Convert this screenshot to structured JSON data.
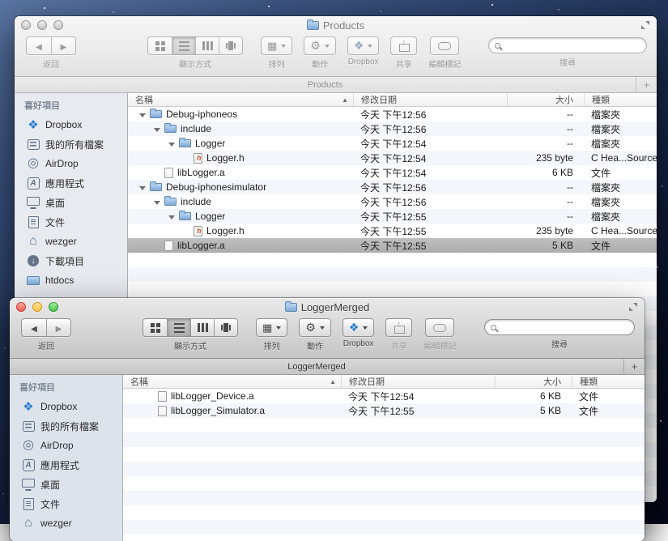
{
  "chrome": {
    "toolbar": {
      "back_label": "返回",
      "view_label": "顯示方式",
      "arrange_label": "排列",
      "action_label": "動作",
      "dropbox_label": "Dropbox",
      "share_label": "共享",
      "tags_label": "編輯標記",
      "search_label": "搜尋",
      "search_value": ""
    },
    "columns": {
      "name": "名稱",
      "date": "修改日期",
      "size": "大小",
      "kind": "種類",
      "sort_asc": "▲"
    },
    "new_tab_label": "+",
    "sidebar": {
      "heading": "喜好項目",
      "items": [
        {
          "label": "Dropbox",
          "icon": "dropbox-icon"
        },
        {
          "label": "我的所有檔案",
          "icon": "all-my-files-icon"
        },
        {
          "label": "AirDrop",
          "icon": "airdrop-icon"
        },
        {
          "label": "應用程式",
          "icon": "applications-icon"
        },
        {
          "label": "桌面",
          "icon": "desktop-icon"
        },
        {
          "label": "文件",
          "icon": "documents-icon"
        },
        {
          "label": "wezger",
          "icon": "home-icon"
        },
        {
          "label": "下載項目",
          "icon": "downloads-icon"
        },
        {
          "label": "htdocs",
          "icon": "folder-icon"
        }
      ]
    }
  },
  "window1": {
    "title": "Products",
    "tab": "Products",
    "rows": [
      {
        "name": "Debug-iphoneos",
        "date": "今天 下午12:56",
        "size": "--",
        "kind": "檔案夾"
      },
      {
        "name": "include",
        "date": "今天 下午12:56",
        "size": "--",
        "kind": "檔案夾"
      },
      {
        "name": "Logger",
        "date": "今天 下午12:54",
        "size": "--",
        "kind": "檔案夾"
      },
      {
        "name": "Logger.h",
        "date": "今天 下午12:54",
        "size": "235 byte",
        "kind": "C Hea...Source"
      },
      {
        "name": "libLogger.a",
        "date": "今天 下午12:54",
        "size": "6 KB",
        "kind": "文件"
      },
      {
        "name": "Debug-iphonesimulator",
        "date": "今天 下午12:56",
        "size": "--",
        "kind": "檔案夾"
      },
      {
        "name": "include",
        "date": "今天 下午12:56",
        "size": "--",
        "kind": "檔案夾"
      },
      {
        "name": "Logger",
        "date": "今天 下午12:55",
        "size": "--",
        "kind": "檔案夾"
      },
      {
        "name": "Logger.h",
        "date": "今天 下午12:55",
        "size": "235 byte",
        "kind": "C Hea...Source"
      },
      {
        "name": "libLogger.a",
        "date": "今天 下午12:55",
        "size": "5 KB",
        "kind": "文件"
      }
    ]
  },
  "window2": {
    "title": "LoggerMerged",
    "tab": "LoggerMerged",
    "rows": [
      {
        "name": "libLogger_Device.a",
        "date": "今天 下午12:54",
        "size": "6 KB",
        "kind": "文件"
      },
      {
        "name": "libLogger_Simulator.a",
        "date": "今天 下午12:55",
        "size": "5 KB",
        "kind": "文件"
      }
    ]
  },
  "colors": {
    "selection_inactive": "#b5b5b5",
    "folder_blue": "#7fa9d6",
    "dropbox_blue": "#2d7dd2",
    "traffic_red": "#f4534c",
    "traffic_yellow": "#fdbb3d",
    "traffic_green": "#32c13a"
  }
}
